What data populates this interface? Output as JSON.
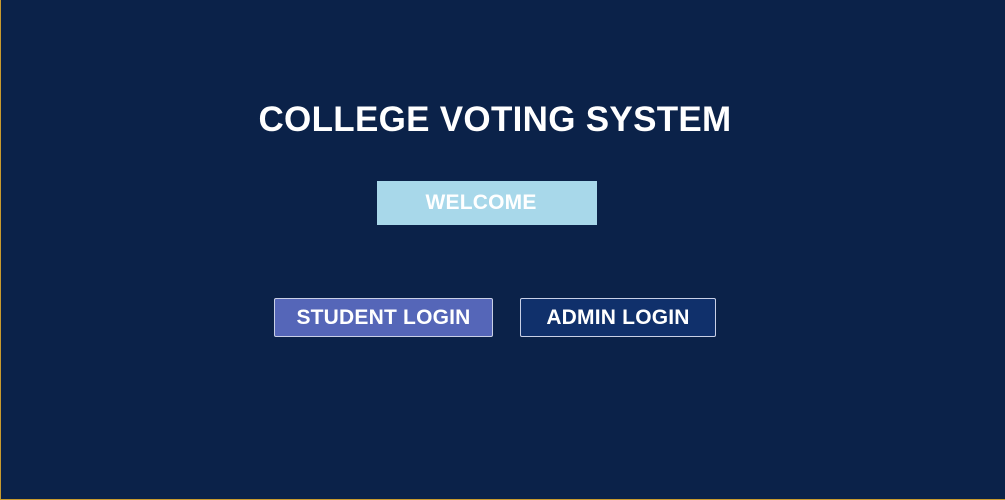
{
  "app": {
    "title": "COLLEGE VOTING SYSTEM",
    "welcome_label": "WELCOME"
  },
  "actions": {
    "student_login_label": "STUDENT LOGIN",
    "admin_login_label": "ADMIN LOGIN"
  },
  "colors": {
    "background": "#0b2249",
    "welcome_bg": "#a8d8ea",
    "student_button_bg": "#5566b8",
    "admin_button_bg": "#10306b",
    "text": "#ffffff",
    "window_border": "#c79a2e"
  }
}
